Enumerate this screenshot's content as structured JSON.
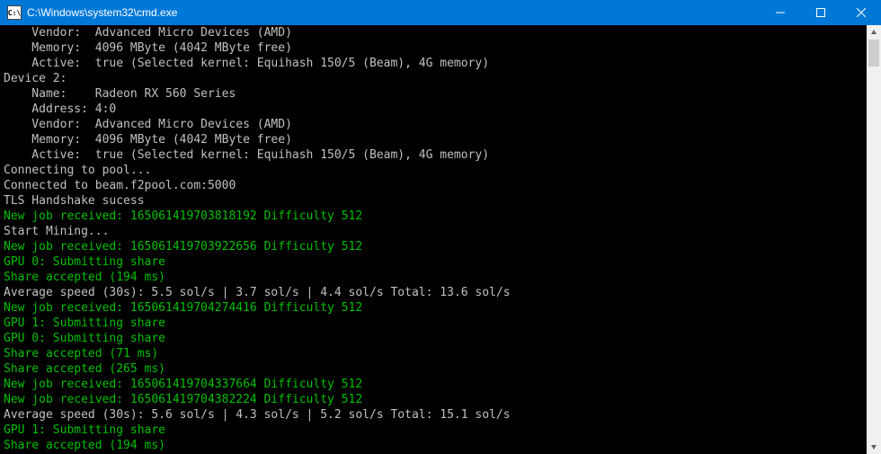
{
  "titlebar": {
    "icon_label": "C:\\",
    "title": "C:\\Windows\\system32\\cmd.exe"
  },
  "lines": [
    {
      "cls": "white",
      "text": "    Vendor:  Advanced Micro Devices (AMD)"
    },
    {
      "cls": "white",
      "text": "    Memory:  4096 MByte (4042 MByte free)"
    },
    {
      "cls": "white",
      "text": "    Active:  true (Selected kernel: Equihash 150/5 (Beam), 4G memory)"
    },
    {
      "cls": "white",
      "text": "Device 2:"
    },
    {
      "cls": "white",
      "text": "    Name:    Radeon RX 560 Series"
    },
    {
      "cls": "white",
      "text": "    Address: 4:0"
    },
    {
      "cls": "white",
      "text": "    Vendor:  Advanced Micro Devices (AMD)"
    },
    {
      "cls": "white",
      "text": "    Memory:  4096 MByte (4042 MByte free)"
    },
    {
      "cls": "white",
      "text": "    Active:  true (Selected kernel: Equihash 150/5 (Beam), 4G memory)"
    },
    {
      "cls": "white",
      "text": ""
    },
    {
      "cls": "white",
      "text": "Connecting to pool..."
    },
    {
      "cls": "white",
      "text": "Connected to beam.f2pool.com:5000"
    },
    {
      "cls": "white",
      "text": "TLS Handshake sucess"
    },
    {
      "cls": "green",
      "text": "New job received: 165061419703818192 Difficulty 512"
    },
    {
      "cls": "white",
      "text": "Start Mining..."
    },
    {
      "cls": "green",
      "text": "New job received: 165061419703922656 Difficulty 512"
    },
    {
      "cls": "green",
      "text": "GPU 0: Submitting share"
    },
    {
      "cls": "green",
      "text": "Share accepted (194 ms)"
    },
    {
      "cls": "white",
      "text": "Average speed (30s): 5.5 sol/s | 3.7 sol/s | 4.4 sol/s Total: 13.6 sol/s"
    },
    {
      "cls": "green",
      "text": "New job received: 165061419704274416 Difficulty 512"
    },
    {
      "cls": "green",
      "text": "GPU 1: Submitting share"
    },
    {
      "cls": "green",
      "text": "GPU 0: Submitting share"
    },
    {
      "cls": "green",
      "text": "Share accepted (71 ms)"
    },
    {
      "cls": "green",
      "text": "Share accepted (265 ms)"
    },
    {
      "cls": "green",
      "text": "New job received: 165061419704337664 Difficulty 512"
    },
    {
      "cls": "green",
      "text": "New job received: 165061419704382224 Difficulty 512"
    },
    {
      "cls": "white",
      "text": "Average speed (30s): 5.6 sol/s | 4.3 sol/s | 5.2 sol/s Total: 15.1 sol/s"
    },
    {
      "cls": "green",
      "text": "GPU 1: Submitting share"
    },
    {
      "cls": "green",
      "text": "Share accepted (194 ms)"
    }
  ]
}
